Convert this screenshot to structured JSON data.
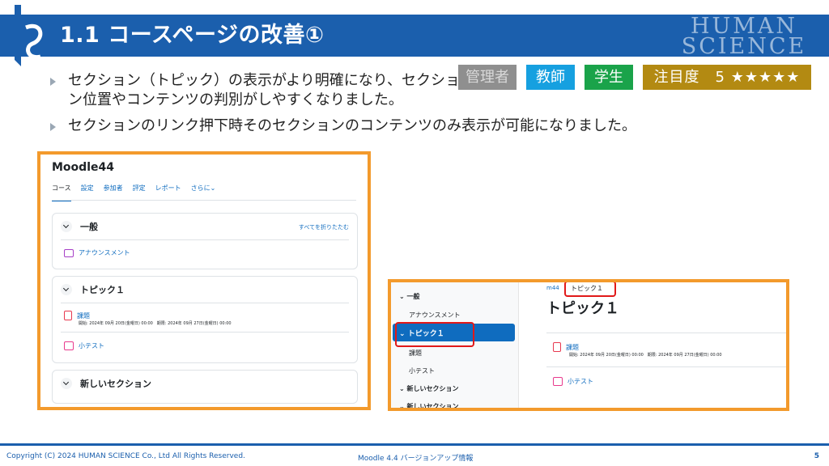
{
  "header": {
    "title": "1.1 コースページの改善①",
    "brand_line1": "HUMAN",
    "brand_line2": "SCIENCE"
  },
  "bullets": [
    "セクション（トピック）の表示がより明確になり、セクション位置やコンテンツの判別がしやすくなりました。",
    "セクションのリンク押下時そのセクションのコンテンツのみ表示が可能になりました。"
  ],
  "badges": {
    "admin": "管理者",
    "teacher": "教師",
    "student": "学生",
    "attention": "注目度　5 ★★★★★"
  },
  "colors": {
    "header_blue": "#1b5fad",
    "frame_orange": "#f39a2c",
    "moodle_blue": "#0f6cbf",
    "highlight_red": "#e11919"
  },
  "course_page": {
    "site_name": "Moodle44",
    "tabs": [
      "コース",
      "設定",
      "参加者",
      "評定",
      "レポート",
      "さらに⌄"
    ],
    "collapse_all": "すべてを折りたたむ",
    "sections": [
      {
        "name": "一般",
        "activities": [
          {
            "icon": "forum-icon",
            "name": "アナウンスメント"
          }
        ]
      },
      {
        "name": "トピック１",
        "activities": [
          {
            "icon": "assignment-icon",
            "name": "課題",
            "dates": "開始: 2024年 09月 20日(金曜日) 00:00　期限: 2024年 09月 27日(金曜日) 00:00"
          },
          {
            "icon": "quiz-icon",
            "name": "小テスト"
          }
        ]
      },
      {
        "name": "新しいセクション",
        "activities": []
      }
    ]
  },
  "section_page": {
    "index": [
      {
        "label": "一般",
        "type": "section"
      },
      {
        "label": "アナウンスメント",
        "type": "activity"
      },
      {
        "label": "トピック１",
        "type": "section",
        "selected": true
      },
      {
        "label": "課題",
        "type": "activity"
      },
      {
        "label": "小テスト",
        "type": "activity"
      },
      {
        "label": "新しいセクション",
        "type": "section"
      },
      {
        "label": "新しいセクション",
        "type": "section"
      }
    ],
    "breadcrumb_root": "m44",
    "breadcrumb_current": "トピック１",
    "title": "トピック１",
    "activities": [
      {
        "icon": "assignment-icon",
        "name": "課題",
        "dates": "開始: 2024年 09月 20日(金曜日) 00:00　期限: 2024年 09月 27日(金曜日) 00:00"
      },
      {
        "icon": "quiz-icon",
        "name": "小テスト"
      }
    ]
  },
  "footer": {
    "copyright": "Copyright (C) 2024 HUMAN SCIENCE Co., Ltd All Rights Reserved.",
    "doc_title": "Moodle 4.4 バージョンアップ情報",
    "page": "5"
  }
}
